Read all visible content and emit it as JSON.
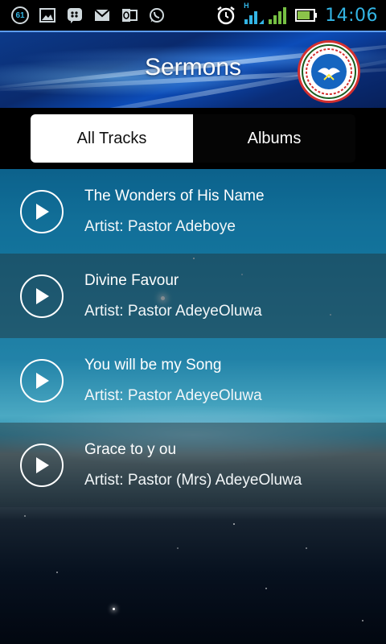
{
  "status_bar": {
    "notification_count": "61",
    "time": "14:06",
    "network_label": "H",
    "icons": [
      "image-icon",
      "bbm-icon",
      "mail-icon",
      "outlook-icon",
      "whatsapp-icon",
      "alarm-icon",
      "signal-icon",
      "battery-icon"
    ]
  },
  "header": {
    "title": "Sermons",
    "logo_text": "THE REDEEMED CHRISTIAN CHURCH OF GOD"
  },
  "tabs": {
    "all_tracks": "All Tracks",
    "albums": "Albums",
    "selected": "All Tracks"
  },
  "tracks": [
    {
      "title": "The Wonders of His Name",
      "artist": "Artist: Pastor Adeboye"
    },
    {
      "title": "Divine Favour",
      "artist": "Artist: Pastor AdeyeOluwa"
    },
    {
      "title": "You will be my Song",
      "artist": "Artist: Pastor AdeyeOluwa"
    },
    {
      "title": "Grace to y ou",
      "artist": "Artist: Pastor (Mrs) AdeyeOluwa"
    }
  ],
  "colors": {
    "clock": "#33b5e5",
    "header_blue": "#0c3a8a",
    "tab_active_bg": "#ffffff",
    "tab_inactive_bg": "#050505",
    "battery_green": "#8bc34a",
    "signal_green": "#76c043",
    "signal_blue": "#33b5e5"
  }
}
